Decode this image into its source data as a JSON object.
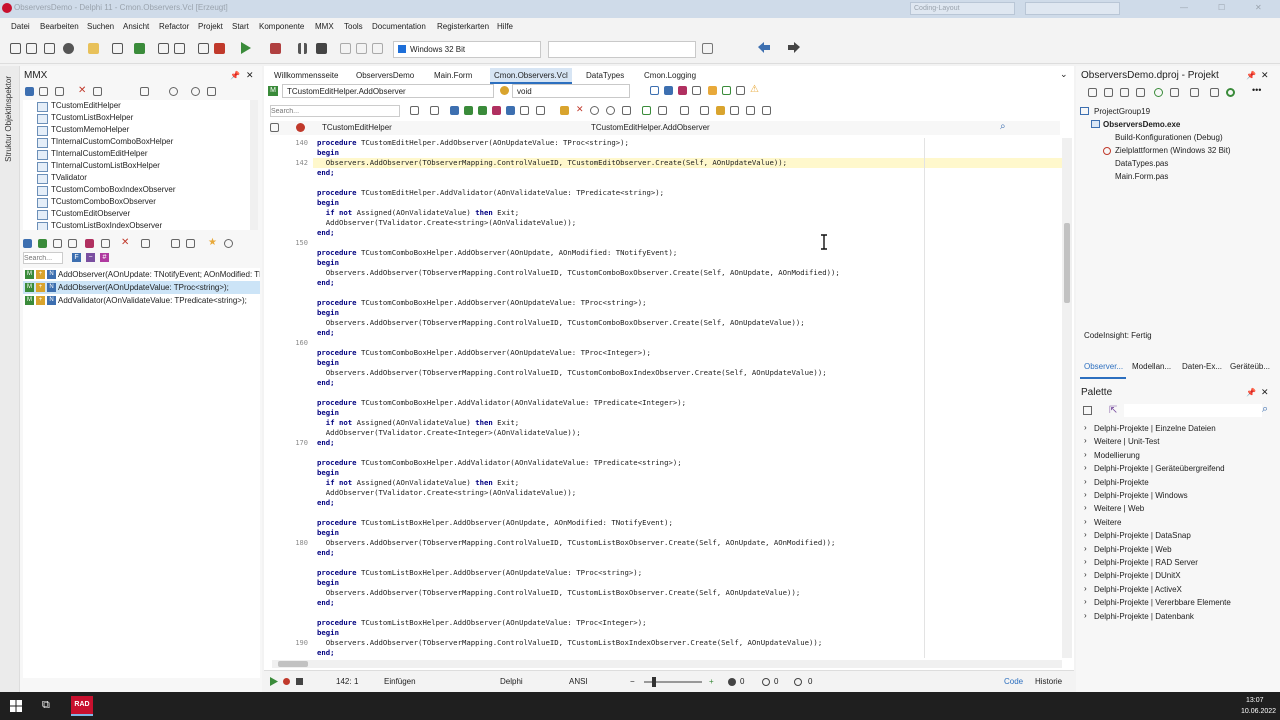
{
  "window": {
    "title": "ObserversDemo - Delphi 11 - Cmon.Observers.Vcl [Erzeugt]",
    "layout_combo": "Coding-Layout"
  },
  "menu": [
    "Datei",
    "Bearbeiten",
    "Suchen",
    "Ansicht",
    "Refactor",
    "Projekt",
    "Start",
    "Komponente",
    "MMX",
    "Tools",
    "Documentation",
    "Registerkarten",
    "Hilfe"
  ],
  "toolbar": {
    "platform": "Windows 32 Bit"
  },
  "left": {
    "side_label": "Struktur  Objektinspektor",
    "title": "MMX",
    "tree": [
      "TCustomEditHelper",
      "TCustomListBoxHelper",
      "TCustomMemoHelper",
      "TInternalCustomComboBoxHelper",
      "TInternalCustomEditHelper",
      "TInternalCustomListBoxHelper",
      "TValidator",
      "TCustomComboBoxIndexObserver",
      "TCustomComboBoxObserver",
      "TCustomEditObserver",
      "TCustomListBoxIndexObserver"
    ],
    "search_placeholder": "Search...",
    "members": [
      "AddObserver(AOnUpdate: TNotifyEvent; AOnModified: TNotifyEvent);",
      "AddObserver(AOnUpdateValue: TProc<string>);",
      "AddValidator(AOnValidateValue: TPredicate<string>);"
    ]
  },
  "editor": {
    "tabs": [
      "Willkommensseite",
      "ObserversDemo",
      "Main.Form",
      "Cmon.Observers.Vcl",
      "DataTypes",
      "Cmon.Logging"
    ],
    "method_combo": "TCustomEditHelper.AddObserver",
    "type_combo": "void",
    "search_placeholder": "Search...",
    "class_nav": "TCustomEditHelper",
    "method_nav": "TCustomEditHelper.AddObserver",
    "line_numbers": [
      {
        "n": "140",
        "row": 0
      },
      {
        "n": "142",
        "row": 2
      },
      {
        "n": "150",
        "row": 10
      },
      {
        "n": "160",
        "row": 20
      },
      {
        "n": "170",
        "row": 30
      },
      {
        "n": "180",
        "row": 40
      },
      {
        "n": "190",
        "row": 50
      }
    ],
    "lines": [
      "procedure TCustomEditHelper.AddObserver(AOnUpdateValue: TProc<string>);",
      "begin",
      "  Observers.AddObserver(TObserverMapping.ControlValueID, TCustomEditObserver.Create(Self, AOnUpdateValue));",
      "end;",
      "",
      "procedure TCustomEditHelper.AddValidator(AOnValidateValue: TPredicate<string>);",
      "begin",
      "  if not Assigned(AOnValidateValue) then Exit;",
      "  AddObserver(TValidator.Create<string>(AOnValidateValue));",
      "end;",
      "",
      "procedure TCustomComboBoxHelper.AddObserver(AOnUpdate, AOnModified: TNotifyEvent);",
      "begin",
      "  Observers.AddObserver(TObserverMapping.ControlValueID, TCustomComboBoxObserver.Create(Self, AOnUpdate, AOnModified));",
      "end;",
      "",
      "procedure TCustomComboBoxHelper.AddObserver(AOnUpdateValue: TProc<string>);",
      "begin",
      "  Observers.AddObserver(TObserverMapping.ControlValueID, TCustomComboBoxObserver.Create(Self, AOnUpdateValue));",
      "end;",
      "",
      "procedure TCustomComboBoxHelper.AddObserver(AOnUpdateValue: TProc<Integer>);",
      "begin",
      "  Observers.AddObserver(TObserverMapping.ControlValueID, TCustomComboBoxIndexObserver.Create(Self, AOnUpdateValue));",
      "end;",
      "",
      "procedure TCustomComboBoxHelper.AddValidator(AOnValidateValue: TPredicate<Integer>);",
      "begin",
      "  if not Assigned(AOnValidateValue) then Exit;",
      "  AddObserver(TValidator.Create<Integer>(AOnValidateValue));",
      "end;",
      "",
      "procedure TCustomComboBoxHelper.AddValidator(AOnValidateValue: TPredicate<string>);",
      "begin",
      "  if not Assigned(AOnValidateValue) then Exit;",
      "  AddObserver(TValidator.Create<string>(AOnValidateValue));",
      "end;",
      "",
      "procedure TCustomListBoxHelper.AddObserver(AOnUpdate, AOnModified: TNotifyEvent);",
      "begin",
      "  Observers.AddObserver(TObserverMapping.ControlValueID, TCustomListBoxObserver.Create(Self, AOnUpdate, AOnModified));",
      "end;",
      "",
      "procedure TCustomListBoxHelper.AddObserver(AOnUpdateValue: TProc<string>);",
      "begin",
      "  Observers.AddObserver(TObserverMapping.ControlValueID, TCustomListBoxObserver.Create(Self, AOnUpdateValue));",
      "end;",
      "",
      "procedure TCustomListBoxHelper.AddObserver(AOnUpdateValue: TProc<Integer>);",
      "begin",
      "  Observers.AddObserver(TObserverMapping.ControlValueID, TCustomListBoxIndexObserver.Create(Self, AOnUpdateValue));",
      "end;"
    ],
    "status": {
      "position": "142:",
      "col": "1",
      "mode": "Einfügen",
      "language": "Delphi",
      "encoding": "ANSI",
      "warnings": "0",
      "hints": "0",
      "errors": "0",
      "tab_code": "Code",
      "tab_history": "Historie"
    }
  },
  "right": {
    "project_title": "ObserversDemo.dproj - Projekt",
    "project": [
      "ProjectGroup19",
      "ObserversDemo.exe",
      "Build-Konfigurationen (Debug)",
      "Zielplattformen (Windows 32 Bit)",
      "DataTypes.pas",
      "Main.Form.pas"
    ],
    "codeinsight": "CodeInsight: Fertig",
    "bottom_tabs": [
      "Observer...",
      "Modellan...",
      "Daten-Ex...",
      "Geräteüb..."
    ],
    "palette_title": "Palette",
    "palette": [
      "Delphi-Projekte | Einzelne Dateien",
      "Weitere | Unit-Test",
      "Modellierung",
      "Delphi-Projekte | Geräteübergreifend",
      "Delphi-Projekte",
      "Delphi-Projekte | Windows",
      "Weitere | Web",
      "Weitere",
      "Delphi-Projekte | DataSnap",
      "Delphi-Projekte | Web",
      "Delphi-Projekte | RAD Server",
      "Delphi-Projekte | DUnitX",
      "Delphi-Projekte | ActiveX",
      "Delphi-Projekte | Vererbbare Elemente",
      "Delphi-Projekte | Datenbank"
    ]
  },
  "taskbar": {
    "app_label": "RAD",
    "time": "13:07",
    "date": "10.06.2022"
  }
}
